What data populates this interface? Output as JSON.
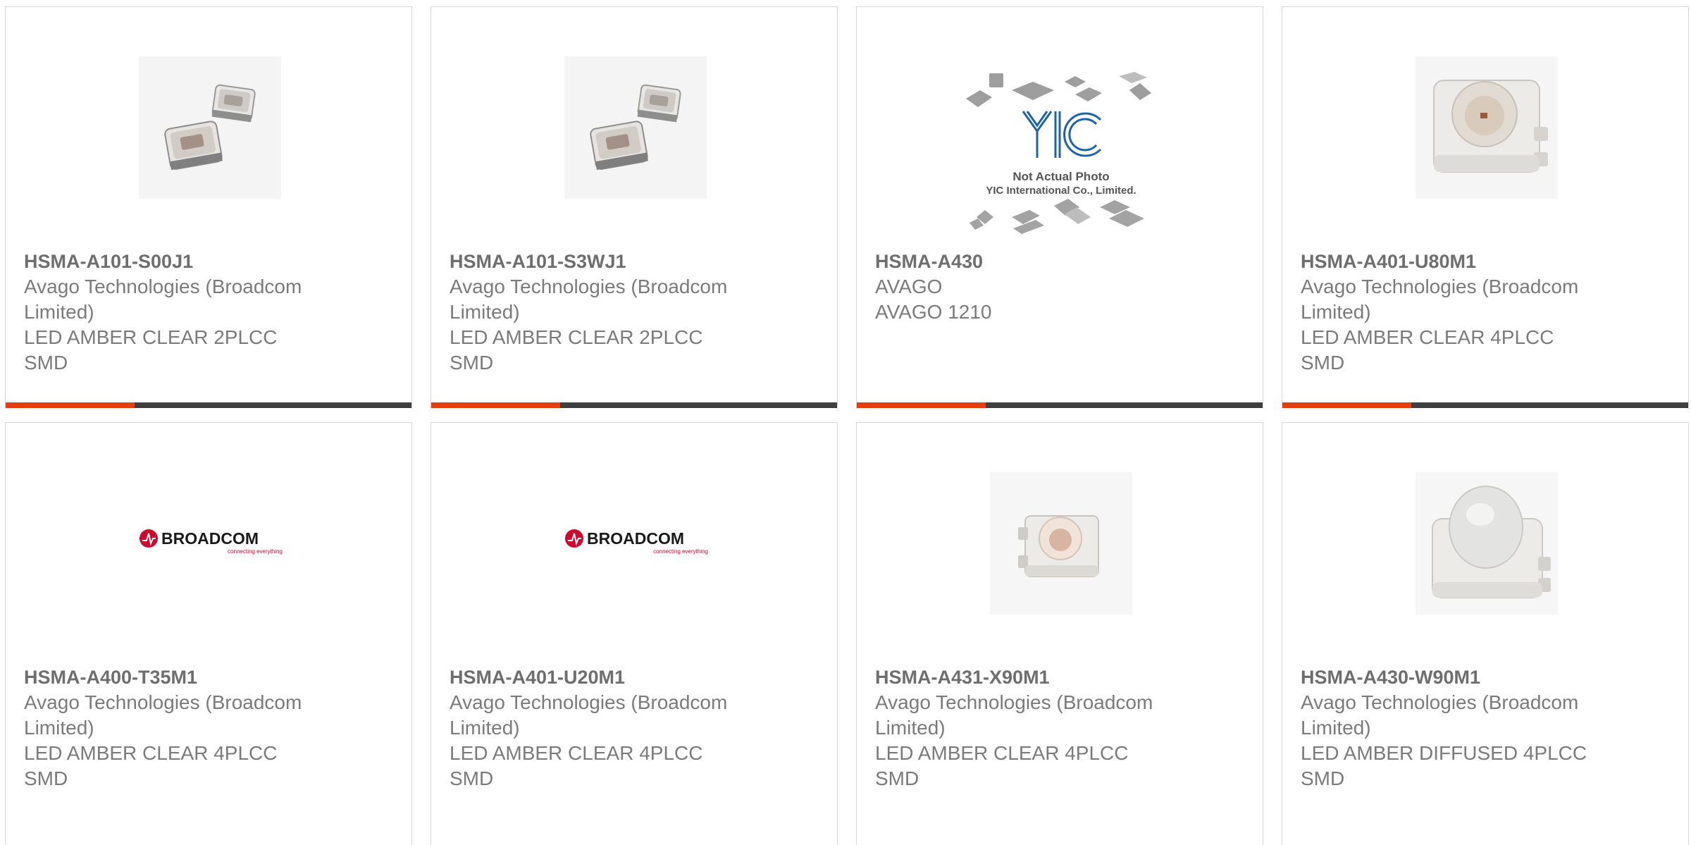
{
  "products": [
    {
      "part": "HSMA-A101-S00J1",
      "manufacturer": "Avago Technologies (Broadcom\nLimited)",
      "description": "LED AMBER CLEAR 2PLCC\nSMD",
      "image": "led-2plcc-icon"
    },
    {
      "part": "HSMA-A101-S3WJ1",
      "manufacturer": "Avago Technologies (Broadcom\nLimited)",
      "description": "LED AMBER CLEAR 2PLCC\nSMD",
      "image": "led-2plcc-icon"
    },
    {
      "part": "HSMA-A430",
      "manufacturer": "AVAGO",
      "description": "AVAGO 1210",
      "image": "not-actual-photo-icon",
      "placeholder_text": "Not Actual Photo",
      "placeholder_company": "YIC International Co., Limited.",
      "placeholder_logo": "YIC"
    },
    {
      "part": "HSMA-A401-U80M1",
      "manufacturer": "Avago Technologies (Broadcom\nLimited)",
      "description": "LED AMBER CLEAR 4PLCC\nSMD",
      "image": "led-4plcc-icon"
    },
    {
      "part": "HSMA-A400-T35M1",
      "manufacturer": "Avago Technologies (Broadcom\nLimited)",
      "description": "LED AMBER CLEAR 4PLCC\nSMD",
      "image": "broadcom-logo-icon",
      "logo_text": "BROADCOM",
      "logo_tagline": "connecting everything"
    },
    {
      "part": "HSMA-A401-U20M1",
      "manufacturer": "Avago Technologies (Broadcom\nLimited)",
      "description": "LED AMBER CLEAR 4PLCC\nSMD",
      "image": "broadcom-logo-icon",
      "logo_text": "BROADCOM",
      "logo_tagline": "connecting everything"
    },
    {
      "part": "HSMA-A431-X90M1",
      "manufacturer": "Avago Technologies (Broadcom\nLimited)",
      "description": "LED AMBER CLEAR 4PLCC\nSMD",
      "image": "led-4plcc-lens-icon"
    },
    {
      "part": "HSMA-A430-W90M1",
      "manufacturer": "Avago Technologies (Broadcom\nLimited)",
      "description": "LED AMBER DIFFUSED 4PLCC\nSMD",
      "image": "led-4plcc-dome-icon"
    }
  ],
  "colors": {
    "accent": "#e53d12",
    "bar": "#3f3f3f",
    "border": "#d6d6d6",
    "text": "#7b7b7b",
    "broadcom_red": "#cc092f"
  }
}
